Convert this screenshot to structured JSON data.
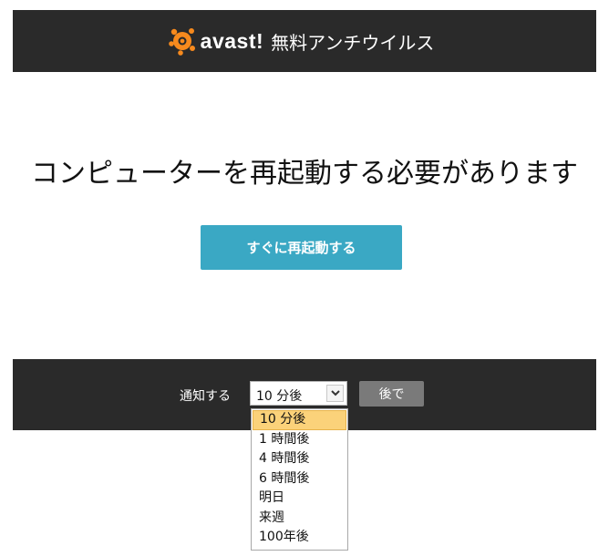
{
  "header": {
    "logo_text": "avast!",
    "product_name": "無料アンチウイルス"
  },
  "main": {
    "title": "コンピューターを再起動する必要があります",
    "restart_button": "すぐに再起動する"
  },
  "footer": {
    "notify_label": "通知する",
    "select_value": "10 分後",
    "later_button": "後で"
  },
  "dropdown": {
    "options": [
      "10 分後",
      "1 時間後",
      "4 時間後",
      "6 時間後",
      "明日",
      "来週",
      "100年後"
    ],
    "selected_index": 0
  },
  "colors": {
    "header_bg": "#2a2a2a",
    "accent_button": "#3aa8c4",
    "logo_orange": "#f78a1d",
    "selected_option": "#fbd27a"
  },
  "icons": {
    "logo": "avast-logo-icon",
    "select_arrow": "chevron-down-icon"
  }
}
